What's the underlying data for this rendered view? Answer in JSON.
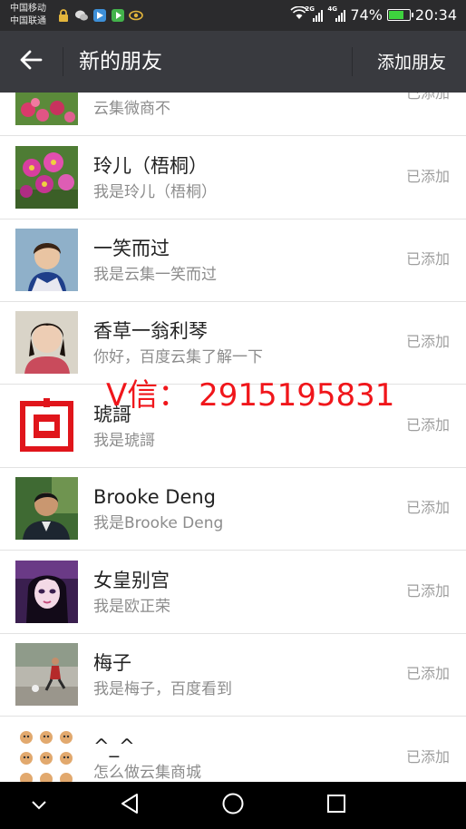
{
  "status_bar": {
    "carrier_1": "中国移动",
    "carrier_2": "中国联通",
    "net_1": "2G",
    "net_2": "4G",
    "battery": "74%",
    "battery_level": 0.74,
    "time": "20:34",
    "app_icons": [
      "lock-icon",
      "wechat-icon",
      "app-icon",
      "media-play-icon",
      "eye-icon"
    ]
  },
  "nav": {
    "back_icon": "back-arrow-icon",
    "title": "新的朋友",
    "action": "添加朋友"
  },
  "friends": [
    {
      "name": "",
      "message": "云集微商不",
      "status": "已添加",
      "avatar": "flowers-avatar"
    },
    {
      "name": "玲儿（梧桐）",
      "message": "我是玲儿（梧桐）",
      "status": "已添加",
      "avatar": "flowers-avatar"
    },
    {
      "name": "一笑而过",
      "message": "我是云集一笑而过",
      "status": "已添加",
      "avatar": "woman-avatar"
    },
    {
      "name": "香草一翁利琴",
      "message": "你好，百度云集了解一下",
      "status": "已添加",
      "avatar": "woman-avatar"
    },
    {
      "name": "琥謌",
      "message": "我是琥謌",
      "status": "已添加",
      "avatar": "red-character-avatar"
    },
    {
      "name": "Brooke Deng",
      "message": "我是Brooke Deng",
      "status": "已添加",
      "avatar": "man-avatar"
    },
    {
      "name": "女皇别宫",
      "message": "我是欧正荣",
      "status": "已添加",
      "avatar": "anime-girl-avatar"
    },
    {
      "name": "梅子",
      "message": "我是梅子，百度看到",
      "status": "已添加",
      "avatar": "outdoor-photo-avatar"
    },
    {
      "name": "^_^",
      "message": "怎么做云集商城",
      "status": "已添加",
      "avatar": "emoji-grid-avatar"
    }
  ],
  "watermark": "V信： 2915195831",
  "system_nav": [
    "collapse-icon",
    "back-triangle-icon",
    "home-circle-icon",
    "recents-square-icon"
  ],
  "colors": {
    "status_bar_bg": "#2b2b2d",
    "nav_bg": "#393a3f",
    "watermark_red": "#f0161b",
    "battery_green": "#3ed13e"
  }
}
